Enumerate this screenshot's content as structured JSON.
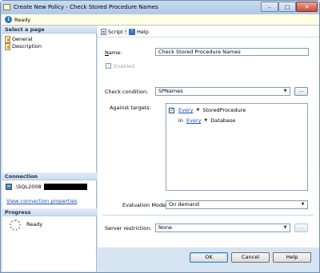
{
  "window": {
    "title": "Create New Policy - Check Stored Procedure Names",
    "controls": {
      "minimize": "–",
      "maximize": "□",
      "close": "✕"
    }
  },
  "status": {
    "icon": "info-icon",
    "text": "Ready"
  },
  "left": {
    "select_page_header": "Select a page",
    "pages": [
      {
        "label": "General",
        "icon": "page-icon"
      },
      {
        "label": "Description",
        "icon": "page-icon"
      }
    ],
    "connection_header": "Connection",
    "connection_server": ".\\SQL2008",
    "view_connection_link": "View connection properties",
    "progress_header": "Progress",
    "progress_status": "Ready"
  },
  "toolbar": {
    "script_label": "Script",
    "script_dropdown": "▾",
    "help_label": "Help"
  },
  "form": {
    "name_label": "Name:",
    "name_value": "Check Stored Procedure Names",
    "enabled_label": "Enabled",
    "enabled_checked": false,
    "check_condition_label": "Check condition:",
    "check_condition_value": "SPNames",
    "ellipsis": "...",
    "against_targets_label": "Against targets:",
    "targets": [
      {
        "checked": true,
        "prefix": "",
        "every": "Every",
        "type": "StoredProcedure"
      },
      {
        "checked": false,
        "prefix": "in",
        "every": "Every",
        "type": "Database"
      }
    ],
    "evaluation_mode_label": "Evaluation Mode:",
    "evaluation_mode_value": "On demand",
    "server_restriction_label": "Server restriction:",
    "server_restriction_value": "None"
  },
  "buttons": {
    "ok": "OK",
    "cancel": "Cancel",
    "help": "Help"
  }
}
